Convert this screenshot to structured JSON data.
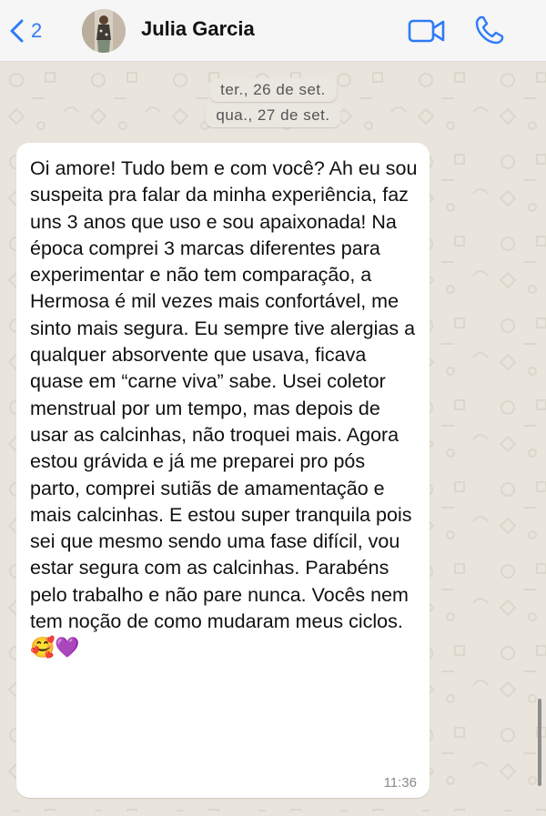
{
  "header": {
    "back_count": "2",
    "contact_name": "Julia Garcia"
  },
  "chat": {
    "dates": [
      "ter., 26 de set.",
      "qua., 27 de set."
    ],
    "message": {
      "text": "Oi amore! Tudo bem e com você? Ah eu sou suspeita pra falar da minha experiência, faz uns 3 anos que uso e sou apaixonada! Na época comprei 3 marcas diferentes para experimentar e não tem comparação, a Hermosa é mil vezes mais confortável, me sinto mais segura. Eu sempre tive alergias a qualquer absorvente que usava, ficava quase em “carne viva” sabe. Usei coletor menstrual por um tempo, mas depois de usar as calcinhas, não troquei mais. Agora estou grávida e já me preparei pro pós parto, comprei sutiãs de amamentação e mais calcinhas. E estou super tranquila pois sei que mesmo sendo uma fase difícil, vou estar segura com as calcinhas. Parabéns pelo trabalho e não pare nunca. Vocês nem tem noção de como mudaram meus ciclos.",
      "emojis": "🥰💜",
      "time": "11:36"
    }
  },
  "icons": {
    "back": "chevron-left-icon",
    "video": "video-camera-icon",
    "call": "phone-icon"
  },
  "colors": {
    "accent": "#2f7bf6",
    "chat_background": "#e9e4dc",
    "bubble": "#ffffff"
  }
}
